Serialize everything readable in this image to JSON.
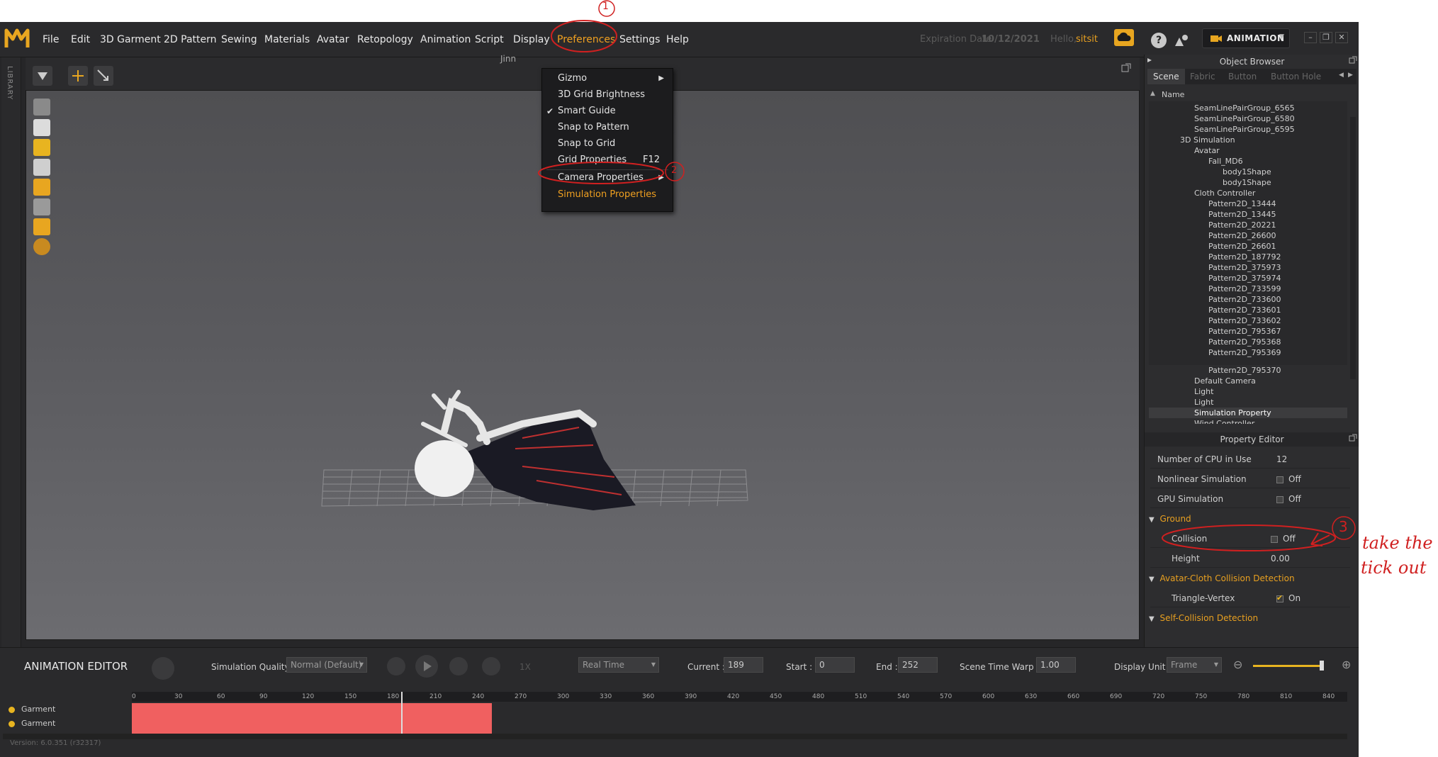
{
  "menubar": {
    "items": [
      "File",
      "Edit",
      "3D Garment",
      "2D Pattern",
      "Sewing",
      "Materials",
      "Avatar",
      "Retopology",
      "Animation",
      "Script",
      "Display",
      "Preferences",
      "Settings",
      "Help"
    ],
    "expiration_label": "Expiration Date",
    "expiration_date": "10/12/2021",
    "hello": "Hello,",
    "user": "sitsit",
    "mode": "ANIMATION"
  },
  "viewport": {
    "title": "Jinn"
  },
  "library_label": "LIBRARY",
  "preferences_menu": [
    {
      "label": "Gizmo",
      "submenu": true
    },
    {
      "label": "3D Grid Brightness"
    },
    {
      "label": "Smart Guide",
      "checked": true
    },
    {
      "label": "Snap to Pattern"
    },
    {
      "label": "Snap to Grid"
    },
    {
      "label": "Grid Properties",
      "shortcut": "F12"
    },
    {
      "label": "Camera Properties",
      "submenu": true
    },
    {
      "label": "Simulation Properties",
      "highlighted": true
    }
  ],
  "object_browser": {
    "title": "Object Browser",
    "tabs": [
      "Scene",
      "Fabric",
      "Button",
      "Button Hole"
    ],
    "column": "Name",
    "tree": [
      "SeamLinePairGroup_6565",
      "SeamLinePairGroup_6580",
      "SeamLinePairGroup_6595",
      "3D Simulation",
      "Avatar",
      "Fall_MD6",
      "body1Shape",
      "body1Shape",
      "Cloth Controller",
      "Pattern2D_13444",
      "Pattern2D_13445",
      "Pattern2D_20221",
      "Pattern2D_26600",
      "Pattern2D_26601",
      "Pattern2D_187792",
      "Pattern2D_375973",
      "Pattern2D_375974",
      "Pattern2D_733599",
      "Pattern2D_733600",
      "Pattern2D_733601",
      "Pattern2D_733602",
      "Pattern2D_795367",
      "Pattern2D_795368",
      "Pattern2D_795369",
      "Pattern2D_795370",
      "Default Camera",
      "Light",
      "Light",
      "Simulation Property",
      "Wind Controller"
    ]
  },
  "property_editor": {
    "title": "Property Editor",
    "cpu_label": "Number of CPU in Use",
    "cpu_value": "12",
    "nonlinear_label": "Nonlinear Simulation",
    "nonlinear_value": "Off",
    "gpu_label": "GPU Simulation",
    "gpu_value": "Off",
    "ground_section": "Ground",
    "collision_label": "Collision",
    "collision_value": "Off",
    "height_label": "Height",
    "height_value": "0.00",
    "avatar_cloth_section": "Avatar-Cloth Collision Detection",
    "triangle_label": "Triangle-Vertex",
    "triangle_value": "On",
    "self_collision_section": "Self-Collision Detection"
  },
  "animation_editor": {
    "title": "ANIMATION EDITOR",
    "sim_quality_label": "Simulation Quality",
    "sim_quality_value": "Normal (Default)",
    "speed": "1X",
    "playback_mode": "Real Time",
    "current_label": "Current :",
    "current_value": "189",
    "start_label": "Start :",
    "start_value": "0",
    "end_label": "End :",
    "end_value": "252",
    "warp_label": "Scene Time Warp",
    "warp_value": "1.00",
    "display_unit_label": "Display Unit",
    "display_unit_value": "Frame",
    "ticks": [
      "0",
      "30",
      "60",
      "90",
      "120",
      "150",
      "180",
      "210",
      "240",
      "270",
      "300",
      "330",
      "360",
      "390",
      "420",
      "450",
      "480",
      "510",
      "540",
      "570",
      "600",
      "630",
      "660",
      "690",
      "720",
      "750",
      "780",
      "810",
      "840"
    ],
    "tracks": [
      "Garment",
      "Garment"
    ],
    "version": "Version: 6.0.351 (r32317)"
  },
  "annotations": {
    "step1": "1",
    "step2": "2",
    "step3": "3",
    "note_line1": "take the",
    "note_line2": "tick out"
  },
  "colors": {
    "accent": "#e8a020",
    "annotation": "#d02020",
    "track": "#f06060"
  }
}
